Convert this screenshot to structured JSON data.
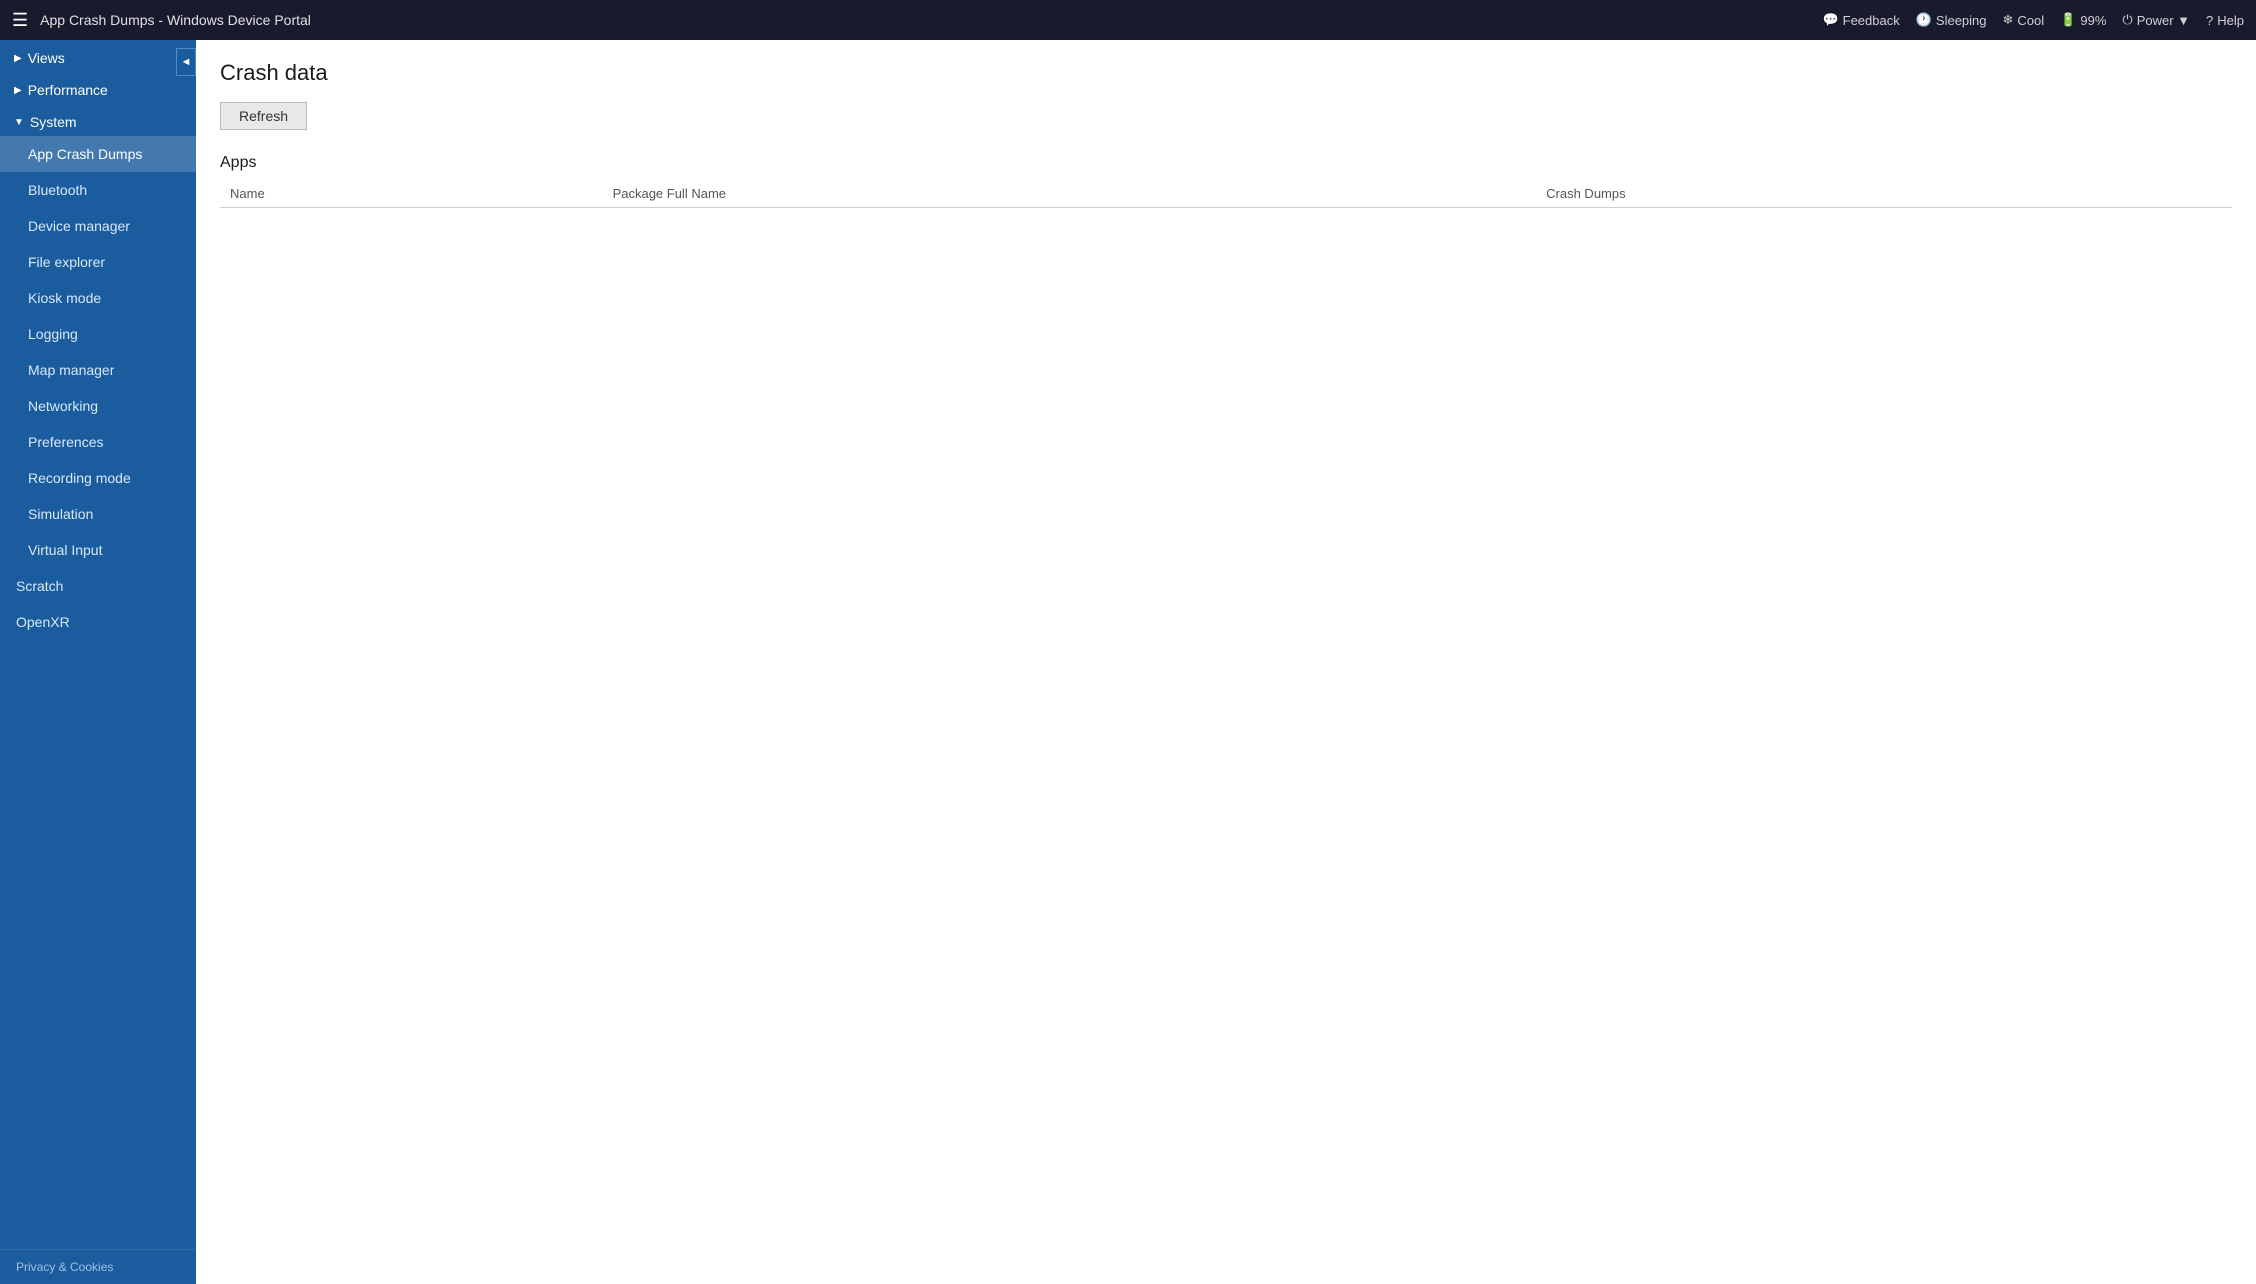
{
  "topbar": {
    "menu_icon": "☰",
    "title": "App Crash Dumps - Windows Device Portal",
    "actions": [
      {
        "id": "feedback",
        "icon": "💬",
        "label": "Feedback"
      },
      {
        "id": "sleeping",
        "icon": "🕐",
        "label": "Sleeping"
      },
      {
        "id": "cool",
        "icon": "❄",
        "label": "Cool"
      },
      {
        "id": "battery",
        "icon": "🔋",
        "label": "99%"
      },
      {
        "id": "power",
        "icon": "⏻",
        "label": "Power ▼"
      },
      {
        "id": "help",
        "icon": "?",
        "label": "Help"
      }
    ]
  },
  "sidebar": {
    "collapse_icon": "◄",
    "sections": [
      {
        "id": "views",
        "label": "Views",
        "arrow": "▶",
        "expanded": false,
        "items": []
      },
      {
        "id": "performance",
        "label": "Performance",
        "arrow": "▶",
        "expanded": false,
        "items": []
      },
      {
        "id": "system",
        "label": "System",
        "arrow": "▼",
        "expanded": true,
        "items": [
          {
            "id": "app-crash-dumps",
            "label": "App Crash Dumps",
            "active": true
          },
          {
            "id": "bluetooth",
            "label": "Bluetooth",
            "active": false
          },
          {
            "id": "device-manager",
            "label": "Device manager",
            "active": false
          },
          {
            "id": "file-explorer",
            "label": "File explorer",
            "active": false
          },
          {
            "id": "kiosk-mode",
            "label": "Kiosk mode",
            "active": false
          },
          {
            "id": "logging",
            "label": "Logging",
            "active": false
          },
          {
            "id": "map-manager",
            "label": "Map manager",
            "active": false
          },
          {
            "id": "networking",
            "label": "Networking",
            "active": false
          },
          {
            "id": "preferences",
            "label": "Preferences",
            "active": false
          },
          {
            "id": "recording-mode",
            "label": "Recording mode",
            "active": false
          },
          {
            "id": "simulation",
            "label": "Simulation",
            "active": false
          },
          {
            "id": "virtual-input",
            "label": "Virtual Input",
            "active": false
          }
        ]
      }
    ],
    "top_level_items": [
      {
        "id": "scratch",
        "label": "Scratch"
      },
      {
        "id": "openxr",
        "label": "OpenXR"
      }
    ],
    "footer": "Privacy & Cookies"
  },
  "content": {
    "page_title": "Crash data",
    "refresh_button_label": "Refresh",
    "apps_section_title": "Apps",
    "table": {
      "columns": [
        {
          "id": "name",
          "label": "Name"
        },
        {
          "id": "package-full-name",
          "label": "Package Full Name"
        },
        {
          "id": "crash-dumps",
          "label": "Crash Dumps"
        }
      ],
      "rows": []
    }
  }
}
